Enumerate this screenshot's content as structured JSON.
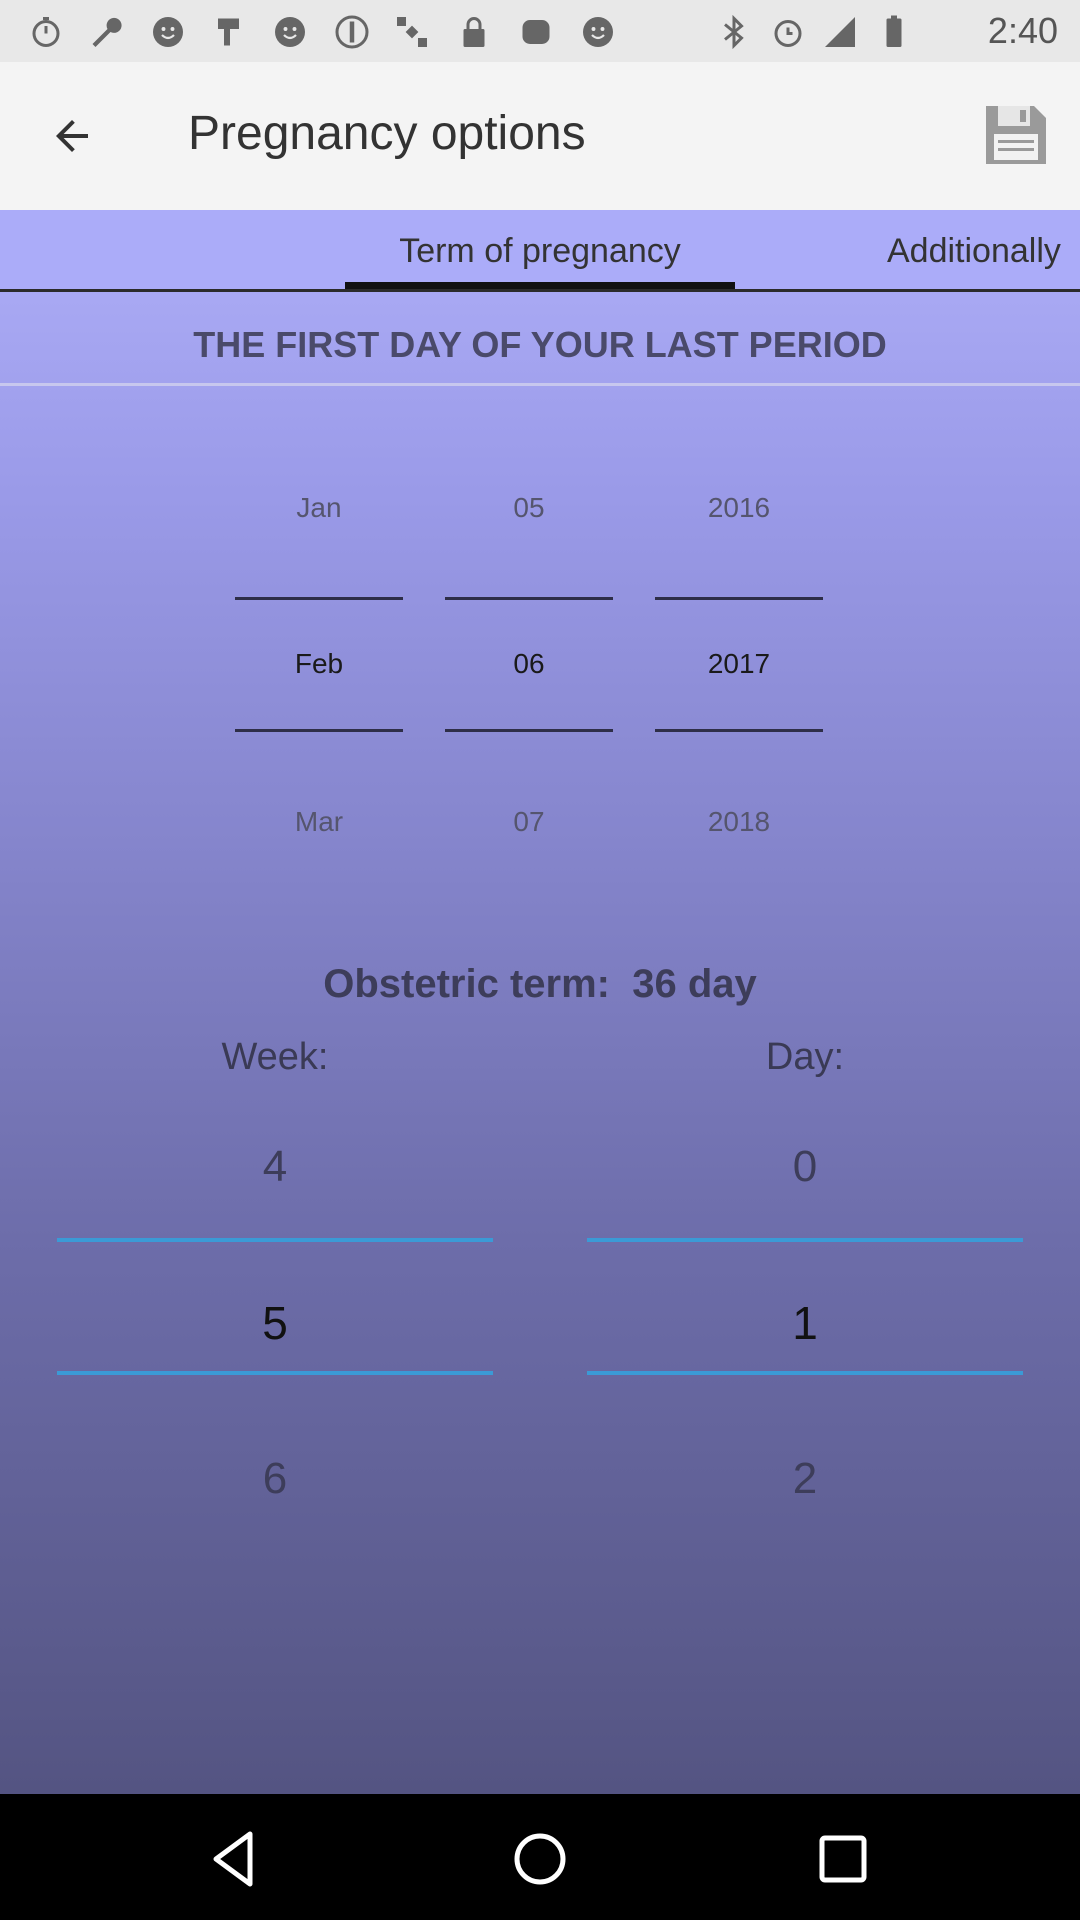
{
  "status_bar": {
    "time": "2:40",
    "icons": [
      "stopwatch-icon",
      "wrench-icon",
      "smiley-icon",
      "flag-icon",
      "smiley-icon",
      "alert-circle-icon",
      "satellite-icon",
      "lock-icon",
      "cup-icon",
      "smiley-icon",
      "bluetooth-icon",
      "alarm-icon",
      "signal-icon",
      "battery-icon"
    ]
  },
  "toolbar": {
    "title": "Pregnancy options",
    "back_icon": "arrow-back-icon",
    "save_icon": "floppy-disk-icon"
  },
  "tabs": [
    {
      "label": "Term of pregnancy",
      "active": true
    },
    {
      "label": "Additionally",
      "active": false
    }
  ],
  "section": {
    "heading": "THE FIRST DAY OF YOUR LAST PERIOD"
  },
  "date_picker": {
    "month": {
      "prev": "Jan",
      "selected": "Feb",
      "next": "Mar"
    },
    "day": {
      "prev": "05",
      "selected": "06",
      "next": "07"
    },
    "year": {
      "prev": "2016",
      "selected": "2017",
      "next": "2018"
    }
  },
  "obstetric": {
    "label": "Obstetric term:",
    "value": "36 day",
    "week_label": "Week:",
    "day_label": "Day:",
    "week": {
      "prev": "4",
      "selected": "5",
      "next": "6"
    },
    "day": {
      "prev": "0",
      "selected": "1",
      "next": "2"
    }
  },
  "colors": {
    "tab_bar": "#abacf9",
    "gradient_top": "#aeaef8",
    "gradient_bottom": "#545482",
    "picker_line": "#3b9ad6"
  },
  "nav_bar": {
    "buttons": [
      "back-triangle-icon",
      "home-circle-icon",
      "recents-square-icon"
    ]
  }
}
